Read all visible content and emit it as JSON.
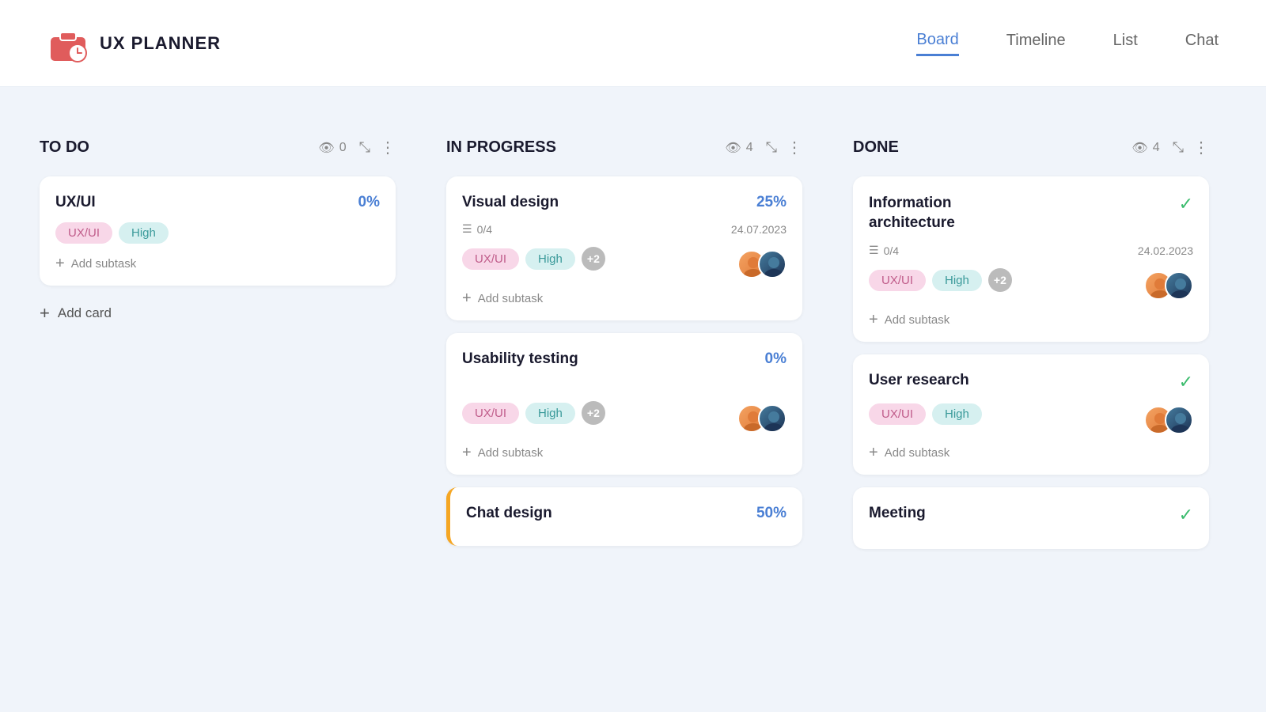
{
  "app": {
    "logo_text": "UX PLANNER"
  },
  "nav": {
    "items": [
      {
        "id": "board",
        "label": "Board",
        "active": true
      },
      {
        "id": "timeline",
        "label": "Timeline",
        "active": false
      },
      {
        "id": "list",
        "label": "List",
        "active": false
      },
      {
        "id": "chat",
        "label": "Chat",
        "active": false
      }
    ]
  },
  "columns": [
    {
      "id": "todo",
      "title": "TO DO",
      "eye_count": "0",
      "cards": [
        {
          "id": "uxui-card",
          "title": "UX/UI",
          "percent": "0%",
          "tags": [
            "UX/UI",
            "High"
          ],
          "add_subtask_label": "Add subtask"
        }
      ],
      "add_card_label": "Add card"
    },
    {
      "id": "in-progress",
      "title": "IN PROGRESS",
      "eye_count": "4",
      "cards": [
        {
          "id": "visual-design",
          "title": "Visual design",
          "percent": "25%",
          "tasks": "0/4",
          "date": "24.07.2023",
          "tags": [
            "UX/UI",
            "High"
          ],
          "extra_tags": "+2",
          "add_subtask_label": "Add subtask"
        },
        {
          "id": "usability-testing",
          "title": "Usability testing",
          "percent": "0%",
          "tags": [
            "UX/UI",
            "High"
          ],
          "extra_tags": "+2",
          "add_subtask_label": "Add subtask"
        },
        {
          "id": "chat-design",
          "title": "Chat design",
          "percent": "50%",
          "orange_border": true
        }
      ]
    },
    {
      "id": "done",
      "title": "DONE",
      "eye_count": "4",
      "cards": [
        {
          "id": "info-arch",
          "title": "Information architecture",
          "done": true,
          "tasks": "0/4",
          "date": "24.02.2023",
          "tags": [
            "UX/UI",
            "High"
          ],
          "extra_tags": "+2",
          "add_subtask_label": "Add subtask"
        },
        {
          "id": "user-research",
          "title": "User research",
          "done": true,
          "tags": [
            "UX/UI",
            "High"
          ],
          "add_subtask_label": "Add subtask"
        },
        {
          "id": "meeting",
          "title": "Meeting",
          "done": true
        }
      ]
    }
  ],
  "icons": {
    "eye": "👁",
    "check": "✓",
    "more": "⋮",
    "plus": "+",
    "tasks": "☰",
    "compress": "⤡"
  }
}
